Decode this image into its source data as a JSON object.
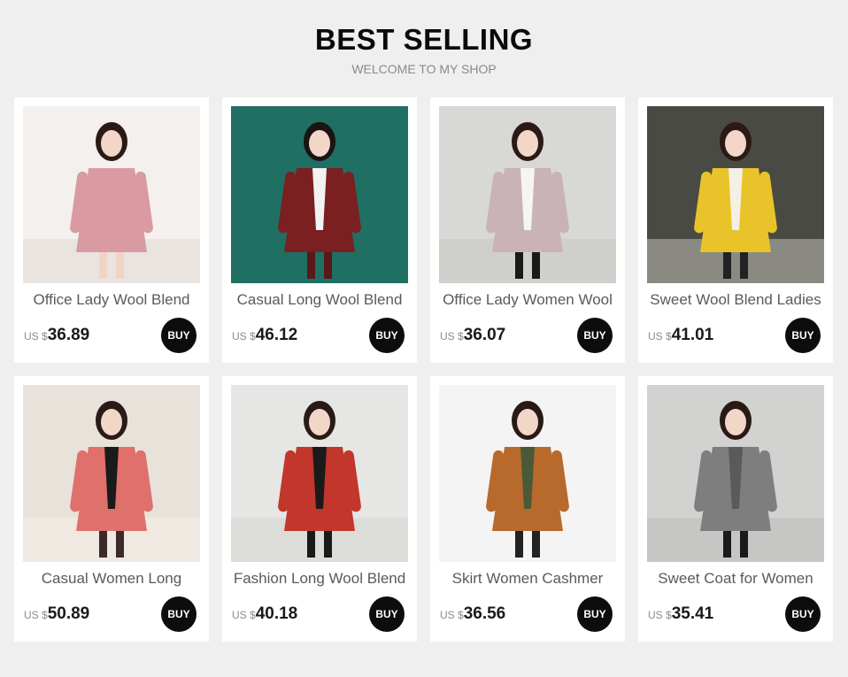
{
  "header": {
    "title": "BEST SELLING",
    "subtitle": "WELCOME TO MY SHOP"
  },
  "currency": "US $",
  "buy_label": "BUY",
  "products": [
    {
      "name": "Office Lady Wool Blend",
      "price": "36.89",
      "scene": {
        "bg": "#f4f0ee",
        "floor": "#e9e4e0",
        "coat": "#d99aa2",
        "inner": "#d99aa2",
        "hair": "#2a1a16",
        "legs": "#f2d3c5"
      }
    },
    {
      "name": "Casual Long Wool Blend",
      "price": "46.12",
      "scene": {
        "bg": "#1f6f63",
        "floor": "#1f6f63",
        "coat": "#7a2020",
        "inner": "#f2f2f2",
        "hair": "#1a1412",
        "legs": "#5a1818"
      }
    },
    {
      "name": "Office Lady Women Wool",
      "price": "36.07",
      "scene": {
        "bg": "#d8d8d6",
        "floor": "#cfcfcc",
        "coat": "#c9b3b6",
        "inner": "#f5f5f5",
        "hair": "#2a1a16",
        "legs": "#1a1a1a"
      }
    },
    {
      "name": "Sweet Wool Blend Ladies",
      "price": "41.01",
      "scene": {
        "bg": "#4a4a44",
        "floor": "#8a8a82",
        "coat": "#e8c42a",
        "inner": "#f5f0e6",
        "hair": "#2a1a16",
        "legs": "#222222"
      }
    },
    {
      "name": "Casual Women Long",
      "price": "50.89",
      "scene": {
        "bg": "#e8e2da",
        "floor": "#efe9e2",
        "coat": "#e0706c",
        "inner": "#1a1a1a",
        "hair": "#2a1a16",
        "legs": "#3a2a2a"
      }
    },
    {
      "name": "Fashion Long Wool Blend",
      "price": "40.18",
      "scene": {
        "bg": "#e6e6e4",
        "floor": "#dcdcd8",
        "coat": "#c2362c",
        "inner": "#1a1a1a",
        "hair": "#2a1a16",
        "legs": "#1a1a1a"
      }
    },
    {
      "name": "Skirt Women Cashmer",
      "price": "36.56",
      "scene": {
        "bg": "#f4f4f4",
        "floor": "#f4f4f4",
        "coat": "#b86a2c",
        "inner": "#4a5a38",
        "hair": "#2a1a16",
        "legs": "#222222"
      }
    },
    {
      "name": "Sweet Coat for Women",
      "price": "35.41",
      "scene": {
        "bg": "#d2d2d0",
        "floor": "#c6c6c4",
        "coat": "#7e7e7e",
        "inner": "#5a5a5a",
        "hair": "#2a1a16",
        "legs": "#1a1a1a"
      }
    }
  ]
}
